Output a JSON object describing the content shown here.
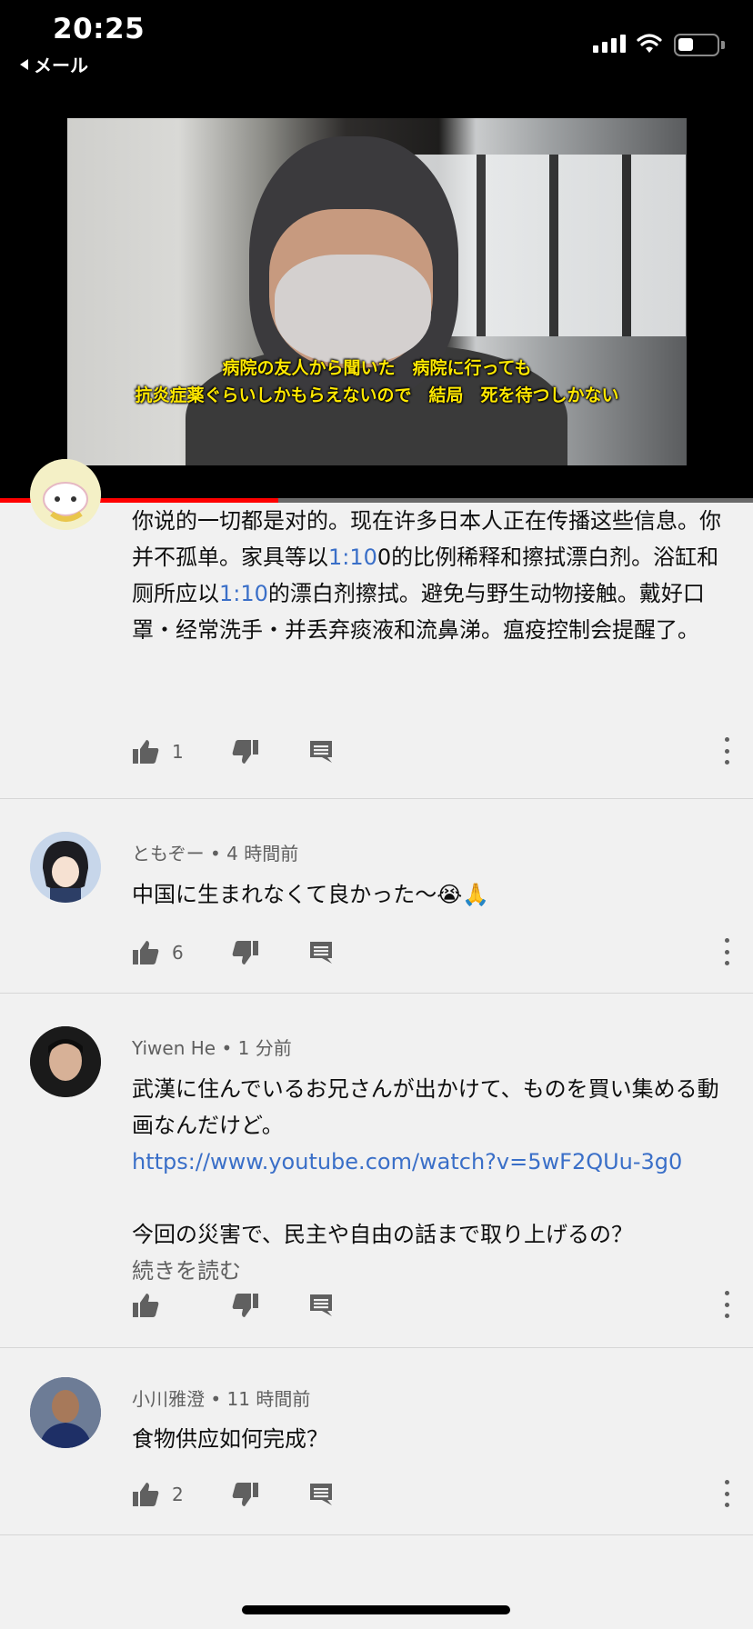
{
  "status_bar": {
    "time": "20:25",
    "back_label": "メール",
    "icons": [
      "cellular-signal-icon",
      "wifi-icon",
      "battery-icon"
    ]
  },
  "video": {
    "subtitle_line1": "病院の友人から聞いた　病院に行っても",
    "subtitle_line2": "抗炎症薬ぐらいしかもらえないので　結局　死を待つしかない",
    "progress_fraction": 0.37,
    "colors": {
      "subtitle": "#ffe800",
      "progress": "#ff0000"
    }
  },
  "comments": [
    {
      "author": "",
      "time": "",
      "text_parts": [
        {
          "t": "你说的一切都是对的。现在许多日本人正在传播这些信息。你并不孤单。家具等以"
        },
        {
          "t": "1:10",
          "link": true
        },
        {
          "t": "0的比例稀释和擦拭漂白剂。浴缸和厕所应以"
        },
        {
          "t": "1:10",
          "link": true
        },
        {
          "t": "的漂白剂擦拭。避免与野生动物接触。戴好口罩・经常洗手・并丢弃痰液和流鼻涕。瘟疫控制会提醒了。"
        }
      ],
      "likes": "1"
    },
    {
      "author": "ともぞー",
      "time": "4 時間前",
      "text_parts": [
        {
          "t": "中国に生まれなくて良かった〜😭🙏"
        }
      ],
      "likes": "6"
    },
    {
      "author": "Yiwen He",
      "time": "1 分前",
      "text_parts": [
        {
          "t": "武漢に住んでいるお兄さんが出かけて、ものを買い集める動画なんだけど。"
        },
        {
          "t": "https://www.youtube.com/watch?v=5wF2QUu-3g0",
          "link": true,
          "block": true
        },
        {
          "t": "",
          "block": true
        },
        {
          "t": "今回の災害で、民主や自由の話まで取り上げるの？",
          "block": true
        },
        {
          "t": "続きを読む",
          "more": true,
          "block": true
        }
      ],
      "likes": ""
    },
    {
      "author": "小川雅澄",
      "time": "11 時間前",
      "text_parts": [
        {
          "t": "食物供应如何完成？"
        }
      ],
      "likes": "2"
    }
  ],
  "meta_separator": " • "
}
